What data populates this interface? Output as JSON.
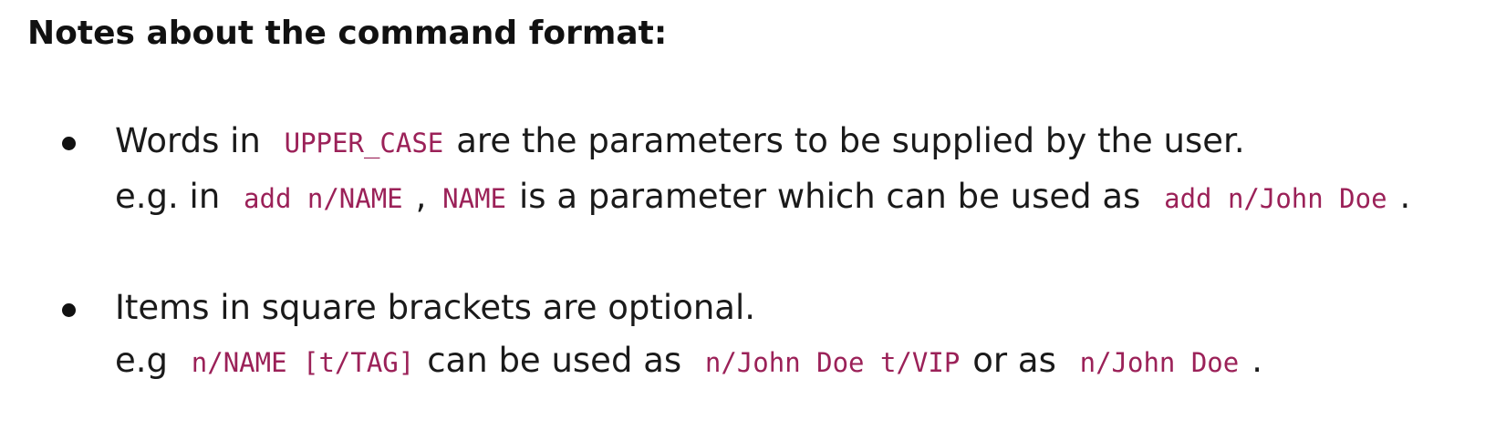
{
  "heading": "Notes about the command format:",
  "notes": [
    {
      "line1": {
        "t1": "Words in",
        "c1": "UPPER_CASE",
        "t2": "are the parameters to be supplied by the user."
      },
      "line2": {
        "t1": "e.g. in",
        "c1": "add n/NAME",
        "t2": ",",
        "c2": "NAME",
        "t3": "is a parameter which can be used as",
        "c3": "add n/John Doe",
        "t4": "."
      }
    },
    {
      "line1": {
        "t1": "Items in square brackets are optional."
      },
      "line2": {
        "t1": "e.g",
        "c1": "n/NAME [t/TAG]",
        "t2": "can be used as",
        "c2": "n/John Doe t/VIP",
        "t3": "or as",
        "c3": "n/John Doe",
        "t4": "."
      }
    }
  ],
  "colors": {
    "text": "#1a1a1a",
    "inline_code": "#9b2158",
    "background": "#ffffff"
  }
}
